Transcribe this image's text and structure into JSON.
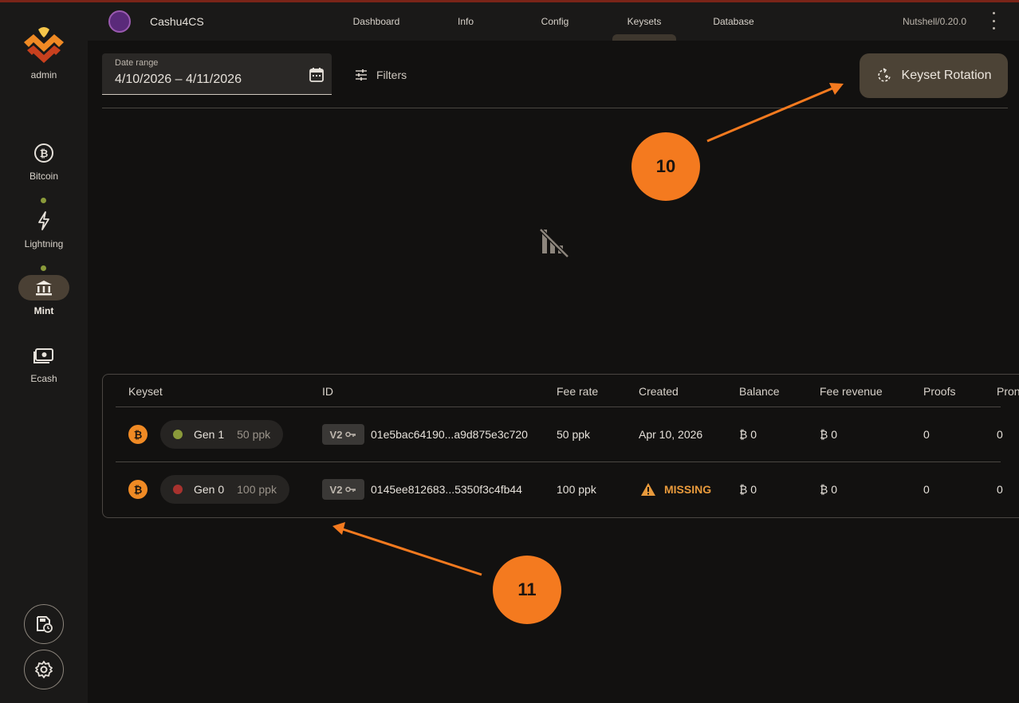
{
  "sidebar": {
    "user_label": "admin",
    "items": [
      {
        "label": "Bitcoin",
        "icon": "bitcoin-icon"
      },
      {
        "label": "Lightning",
        "icon": "lightning-icon"
      },
      {
        "label": "Mint",
        "icon": "bank-icon"
      },
      {
        "label": "Ecash",
        "icon": "cash-icon"
      }
    ],
    "bottom_buttons": [
      {
        "icon": "save-clock-icon"
      },
      {
        "icon": "settings-icon"
      }
    ]
  },
  "header": {
    "app_title": "Cashu4CS",
    "tabs": [
      "Dashboard",
      "Info",
      "Config",
      "Keysets",
      "Database"
    ],
    "active_tab": "Keysets",
    "version": "Nutshell/0.20.0"
  },
  "controls": {
    "date_range_label": "Date range",
    "date_range_value": "4/10/2026 – 4/11/2026",
    "filters_label": "Filters",
    "rotation_button_label": "Keyset Rotation"
  },
  "table": {
    "columns": [
      "Keyset",
      "ID",
      "Fee rate",
      "Created",
      "Balance",
      "Fee revenue",
      "Proofs",
      "Pron"
    ],
    "rows": [
      {
        "generation": "Gen 1",
        "ppk": "50 ppk",
        "status_color": "#8a9a3a",
        "version": "V2",
        "id": "01e5bac64190...a9d875e3c720",
        "fee_rate": "50 ppk",
        "created": "Apr 10, 2026",
        "balance": "₿ 0",
        "fee_revenue": "₿ 0",
        "proofs": "0",
        "pron": "0"
      },
      {
        "generation": "Gen 0",
        "ppk": "100 ppk",
        "status_color": "#a8322e",
        "version": "V2",
        "id": "0145ee812683...5350f3c4fb44",
        "fee_rate": "100 ppk",
        "created": "MISSING",
        "balance": "₿ 0",
        "fee_revenue": "₿ 0",
        "proofs": "0",
        "pron": "0"
      }
    ]
  },
  "annotations": {
    "badge_1": "10",
    "badge_2": "11",
    "color": "#f47a1f"
  }
}
